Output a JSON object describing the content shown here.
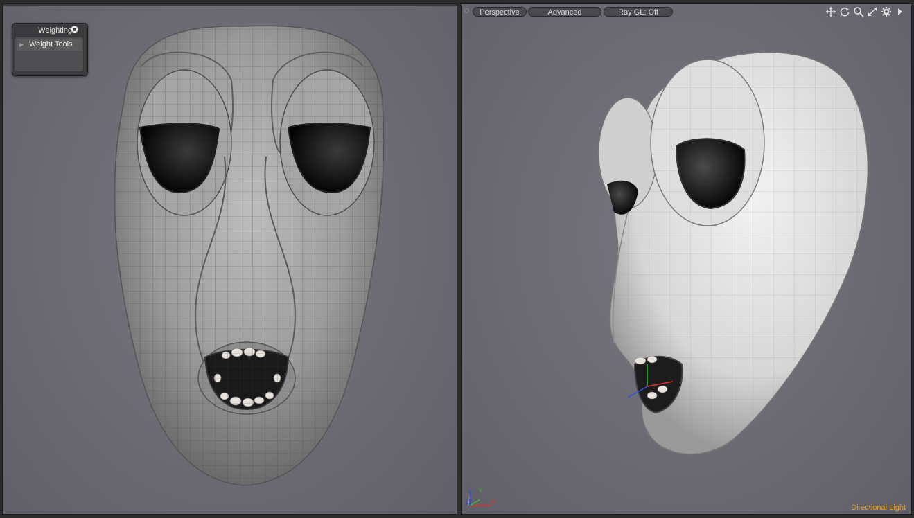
{
  "left_viewport": {
    "panel": {
      "title": "Weighting",
      "item_label": "Weight Tools"
    }
  },
  "right_viewport": {
    "toolbar": {
      "view_mode": "Perspective",
      "shading": "Advanced",
      "raygl": "Ray GL: Off"
    },
    "toolbar_icons": [
      "move-view-icon",
      "rotate-view-icon",
      "zoom-view-icon",
      "fit-view-icon",
      "settings-gear-icon",
      "expand-arrow-icon"
    ],
    "status_label": "Directional Light",
    "axes": [
      "Y",
      "Z",
      "X"
    ]
  },
  "colors": {
    "viewport_bg": "#6c6b73",
    "status_label": "#e6a42a",
    "axis_x": "#e03030",
    "axis_y": "#30c030",
    "axis_z": "#3050e0"
  }
}
